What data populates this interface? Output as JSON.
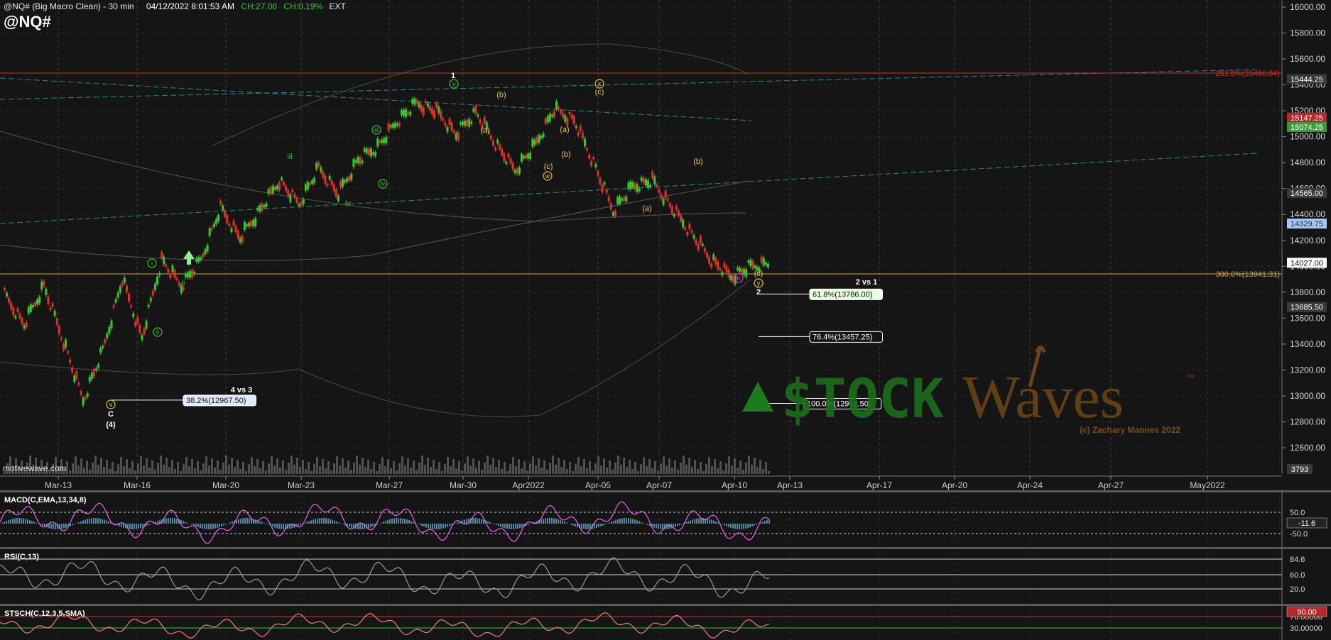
{
  "header": {
    "title": "@NQ# (Big Macro Clean) - 30 min",
    "datetime": "04/12/2022 8:01:53 AM",
    "change": "CH:27.00",
    "change_pct": "CH:0.19%",
    "session": "EXT",
    "symbol": "@NQ#"
  },
  "source": "motivewave.com",
  "watermark": {
    "brand_left": "$TOCK",
    "brand_right": "Waves",
    "trademark": "™",
    "copyright": "(c) Zachary Mannes 2022"
  },
  "colors": {
    "background": "#151515",
    "bull_candle": "#39c62d",
    "bear_candle": "#e0302a",
    "wave_green": "#39c62d",
    "wave_yellow": "#e4c34d",
    "fib_red": "#d0302a",
    "fib_gold": "#d9a520",
    "channel_teal": "#2aa5a5",
    "macd_line": "#f060f0",
    "macd_hist": "#6ab6d8"
  },
  "chart_data": {
    "type": "line",
    "title": "@NQ# (Big Macro Clean) - 30 min",
    "price_axis": {
      "ticks": [
        16000,
        15800,
        15600,
        15400,
        15200,
        15000,
        14800,
        14600,
        14400,
        14200,
        14000,
        13800,
        13600,
        13400,
        13200,
        13000,
        12800,
        12600
      ],
      "tick_labels": [
        "16000.00",
        "15800.00",
        "15600.00",
        "15400.00",
        "15200.00",
        "15000.00",
        "14800.00",
        "14600.00",
        "14400.00",
        "14200.00",
        "14000.00",
        "13800.00",
        "13600.00",
        "13400.00",
        "13200.00",
        "13000.00",
        "12800.00",
        "12600.00"
      ],
      "range": [
        12390,
        16030
      ]
    },
    "date_axis": {
      "labels": [
        "Mar-13",
        "Mar-16",
        "Mar-20",
        "Mar-23",
        "Mar-27",
        "Mar-30",
        "Apr2022",
        "Apr-05",
        "Apr-07",
        "Apr-10",
        "Apr-13",
        "Apr-17",
        "Apr-20",
        "Apr-24",
        "Apr-27",
        "May2022"
      ]
    },
    "price_path": [
      {
        "date": "Mar-13",
        "price": 13780
      },
      {
        "date": "Mar-14",
        "price": 13550
      },
      {
        "date": "Mar-14b",
        "price": 13850
      },
      {
        "date": "Mar-15",
        "price": 13420
      },
      {
        "date": "Mar-15b",
        "price": 12965
      },
      {
        "date": "Mar-16",
        "price": 13350
      },
      {
        "date": "Mar-16b",
        "price": 13900
      },
      {
        "date": "Mar-17",
        "price": 13450
      },
      {
        "date": "Mar-17b",
        "price": 14050
      },
      {
        "date": "Mar-18",
        "price": 13850
      },
      {
        "date": "Mar-19",
        "price": 14050
      },
      {
        "date": "Mar-20",
        "price": 14450
      },
      {
        "date": "Mar-21",
        "price": 14220
      },
      {
        "date": "Mar-22",
        "price": 14430
      },
      {
        "date": "Mar-23",
        "price": 14660
      },
      {
        "date": "Mar-24",
        "price": 14480
      },
      {
        "date": "Mar-25",
        "price": 14760
      },
      {
        "date": "Mar-26",
        "price": 14560
      },
      {
        "date": "Mar-27",
        "price": 14820
      },
      {
        "date": "Mar-28",
        "price": 14920
      },
      {
        "date": "Mar-29",
        "price": 15120
      },
      {
        "date": "Mar-29b",
        "price": 15260
      },
      {
        "date": "Mar-30",
        "price": 15200
      },
      {
        "date": "Mar-31",
        "price": 15020
      },
      {
        "date": "Mar-31b",
        "price": 15190
      },
      {
        "date": "Apr-01",
        "price": 14950
      },
      {
        "date": "Apr-02",
        "price": 14740
      },
      {
        "date": "Apr-03",
        "price": 14930
      },
      {
        "date": "Apr-04",
        "price": 15210
      },
      {
        "date": "Apr-05",
        "price": 15130
      },
      {
        "date": "Apr-05b",
        "price": 14800
      },
      {
        "date": "Apr-06",
        "price": 14430
      },
      {
        "date": "Apr-07",
        "price": 14620
      },
      {
        "date": "Apr-08",
        "price": 14660
      },
      {
        "date": "Apr-08b",
        "price": 14450
      },
      {
        "date": "Apr-09",
        "price": 14250
      },
      {
        "date": "Apr-10",
        "price": 14050
      },
      {
        "date": "Apr-11",
        "price": 13920
      },
      {
        "date": "Apr-12",
        "price": 14000
      },
      {
        "date": "Apr-12b",
        "price": 14027
      }
    ],
    "price_labels": [
      {
        "label": "15444.25",
        "price": 15444.25,
        "bg": "#3a3a3a",
        "fg": "#ffffff"
      },
      {
        "label": "15147.25",
        "price": 15147.25,
        "bg": "#b32a2a",
        "fg": "#ffffff"
      },
      {
        "label": "15074.25",
        "price": 15074.25,
        "bg": "#3a9d3a",
        "fg": "#ffffff"
      },
      {
        "label": "14565.00",
        "price": 14565,
        "bg": "#3a3a3a",
        "fg": "#ffffff"
      },
      {
        "label": "14329.75",
        "price": 14329.75,
        "bg": "#a7c7f0",
        "fg": "#10305a"
      },
      {
        "label": "14027.00",
        "price": 14027,
        "bg": "#ffffff",
        "fg": "#111111"
      },
      {
        "label": "13685.50",
        "price": 13685.5,
        "bg": "#3a3a3a",
        "fg": "#ffffff"
      }
    ],
    "fib_levels": [
      {
        "label": "261.8%(15490.84)",
        "price": 15490.84,
        "color": "#d0302a"
      },
      {
        "label": "300.0%(13941.31)",
        "price": 13941.31,
        "color": "#d9a520"
      }
    ],
    "fib_boxes": [
      {
        "label": "61.8%(13786.00)",
        "price": 13786,
        "style": "green"
      },
      {
        "label": "76.4%(13457.25)",
        "price": 13457.25,
        "style": "dark"
      },
      {
        "label": "100.0%(12942.50)",
        "price": 12942.5,
        "style": "dark"
      },
      {
        "label": "38.2%(12967.50)",
        "price": 12967.5,
        "style": "blue"
      }
    ],
    "annotations": [
      {
        "text": "2 vs 1",
        "price": 13880
      },
      {
        "text": "4 vs 3",
        "price": 13050
      }
    ],
    "wave_labels": [
      {
        "text": "1",
        "price": 15400,
        "color": "white"
      },
      {
        "text": "v",
        "price": 15310,
        "color": "green",
        "circled": true
      },
      {
        "text": "iii",
        "price": 14730,
        "color": "green"
      },
      {
        "text": "iii",
        "price": 14940,
        "color": "green",
        "circled": true
      },
      {
        "text": "iv",
        "price": 14440,
        "color": "green"
      },
      {
        "text": "iv",
        "price": 14620,
        "color": "green",
        "circled": true
      },
      {
        "text": "i",
        "price": 13990,
        "color": "green",
        "circled": true
      },
      {
        "text": "ii",
        "price": 13360,
        "color": "green",
        "circled": true
      },
      {
        "text": "ii",
        "price": 13850,
        "color": "green"
      },
      {
        "text": "v",
        "price": 12910,
        "color": "yellow",
        "circled": true
      },
      {
        "text": "C",
        "price": 12850,
        "color": "white"
      },
      {
        "text": "(4)",
        "price": 12730,
        "color": "white"
      },
      {
        "text": "(b)",
        "price": 15240,
        "color": "yellow"
      },
      {
        "text": "(a)",
        "price": 15000,
        "color": "yellow"
      },
      {
        "text": "(a)",
        "price": 15010,
        "color": "yellow"
      },
      {
        "text": "(b)",
        "price": 14820,
        "color": "yellow"
      },
      {
        "text": "(c)",
        "price": 14700,
        "color": "yellow"
      },
      {
        "text": "w",
        "price": 14630,
        "color": "yellow",
        "circled": true
      },
      {
        "text": "x",
        "price": 15330,
        "color": "yellow",
        "circled": true
      },
      {
        "text": "(c)",
        "price": 15280,
        "color": "yellow"
      },
      {
        "text": "(b)",
        "price": 14660,
        "color": "yellow"
      },
      {
        "text": "(a)",
        "price": 14330,
        "color": "yellow"
      },
      {
        "text": "b",
        "price": 13800,
        "color": "magenta",
        "circled": true
      },
      {
        "text": "(c)",
        "price": 13830,
        "color": "yellow"
      },
      {
        "text": "y",
        "price": 13740,
        "color": "yellow",
        "circled": true
      },
      {
        "text": "2",
        "price": 13680,
        "color": "white"
      }
    ],
    "indicators": [
      {
        "name": "MACD(C,EMA,13,34,8)",
        "ticks": [
          "50.0",
          "-50.0"
        ],
        "value": "-11.6"
      },
      {
        "name": "RSI(C,13)",
        "ticks": [
          "84.6",
          "60.0",
          "20.0"
        ]
      },
      {
        "name": "STSCH(C,12,3,5,SMA)",
        "ticks": [
          "70.00000",
          "30.00000"
        ],
        "value": "90.00"
      }
    ],
    "volume_axis_label": "3793",
    "grid": true,
    "log_scale": false
  }
}
